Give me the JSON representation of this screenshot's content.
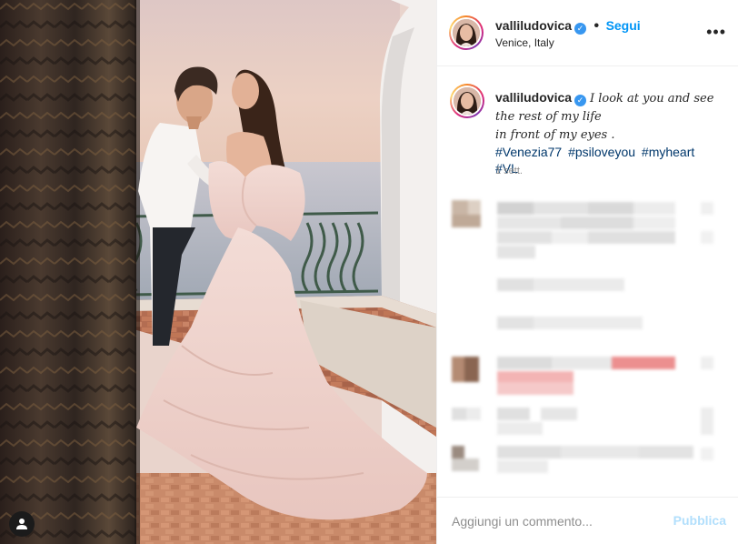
{
  "post": {
    "username": "valliludovica",
    "verified": true,
    "follow_label": "Segui",
    "separator": "•",
    "location": "Venice, Italy",
    "more_label": "•••"
  },
  "caption": {
    "username": "valliludovica",
    "text": "I look at you and see\nthe rest of my life\nin front of my eyes .",
    "hashtags": [
      "#Venezia77",
      "#psiloveyou",
      "#myheart",
      "#VL"
    ],
    "time_ago": "1 sett."
  },
  "comment_box": {
    "placeholder": "Aggiungi un commento...",
    "publish_label": "Pubblica"
  },
  "colors": {
    "accent": "#0095f6",
    "verified": "#3897f0",
    "hashtag": "#00376b",
    "publish_disabled": "#b2dffc"
  }
}
